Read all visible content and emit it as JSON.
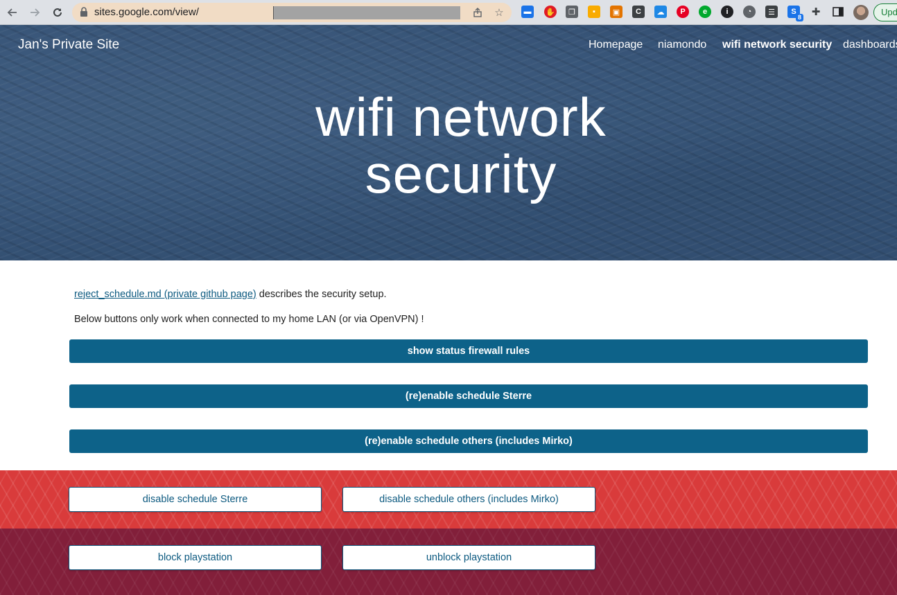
{
  "browser": {
    "url": "sites.google.com/view/",
    "update_label": "Upd",
    "extension_badge": "8",
    "extension_c_label": "C"
  },
  "site": {
    "title": "Jan's Private Site",
    "nav": [
      {
        "label": "Homepage",
        "active": false
      },
      {
        "label": "niamondo",
        "active": false
      },
      {
        "label": "wifi network security",
        "active": true
      },
      {
        "label": "dashboards",
        "active": false
      }
    ]
  },
  "hero": {
    "title_line1": "wifi network",
    "title_line2": "security"
  },
  "content": {
    "link_text": "reject_schedule.md (private github page)",
    "link_suffix": " describes the security setup.",
    "note": "Below buttons only work when connected to my home LAN (or via OpenVPN) !",
    "buttons": [
      "show status firewall rules",
      "(re)enable schedule Sterre",
      "(re)enable schedule others (includes Mirko)"
    ]
  },
  "red_section": {
    "buttons": [
      "disable schedule Sterre",
      "disable schedule others (includes Mirko)"
    ]
  },
  "maroon_section": {
    "buttons": [
      "block playstation",
      "unblock playstation"
    ]
  },
  "colors": {
    "primary_button": "#0d6289",
    "red_band": "#d93b3b",
    "maroon_band": "#821f3a"
  }
}
